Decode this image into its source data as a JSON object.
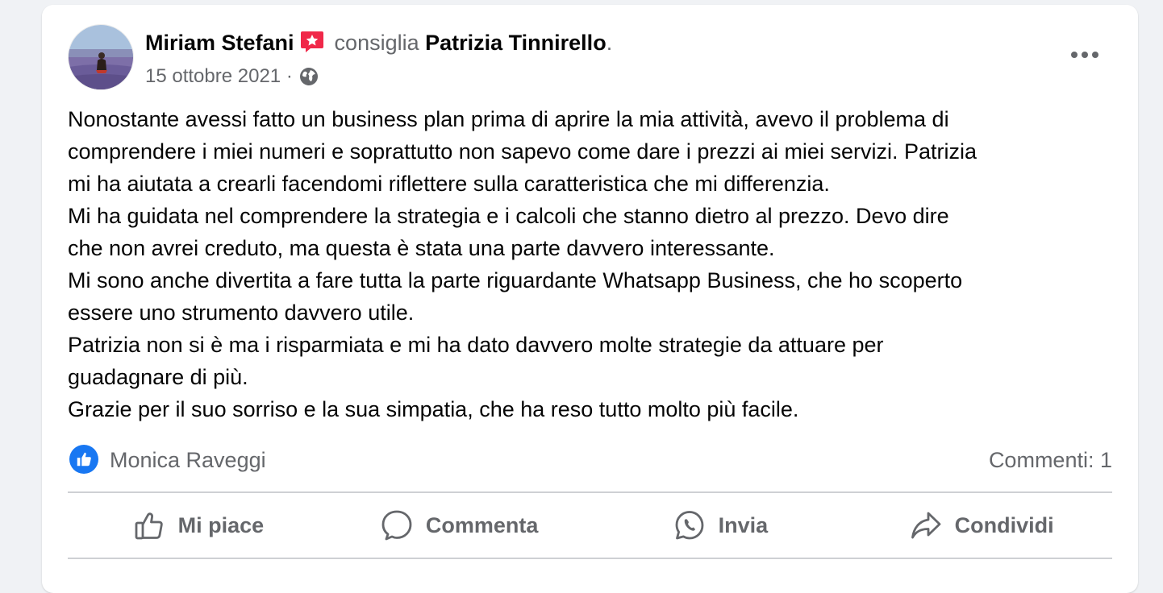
{
  "post": {
    "author": "Miriam Stefani",
    "verb": "consiglia",
    "page": "Patrizia Tinnirello",
    "page_end": ".",
    "date": "15 ottobre 2021",
    "date_sep": "·",
    "body_lines": [
      "Nonostante avessi fatto un business plan prima di aprire la mia attività, avevo il problema di",
      "comprendere i miei numeri e soprattutto  non sapevo come dare i prezzi ai miei servizi. Patrizia",
      "mi ha aiutata a crearli facendomi riflettere sulla caratteristica che mi differenzia.",
      "Mi ha guidata nel comprendere la strategia e i calcoli che stanno dietro al prezzo. Devo dire",
      "che non avrei creduto, ma questa è stata una parte davvero interessante.",
      "Mi sono anche divertita a fare tutta la parte riguardante Whatsapp Business, che ho scoperto",
      "essere uno strumento davvero utile.",
      "Patrizia non si è ma i risparmiata e mi ha dato davvero molte strategie da attuare per",
      "guadagnare di più.",
      "Grazie per il suo sorriso e la sua simpatia, che ha reso tutto molto più facile."
    ]
  },
  "reactions": {
    "reactor": "Monica Raveggi",
    "comments": "Commenti: 1"
  },
  "actions": {
    "like": "Mi piace",
    "comment": "Commenta",
    "send": "Invia",
    "share": "Condividi"
  },
  "icons": {
    "recommend": "recommend-star-icon",
    "globe": "globe-icon",
    "more": "more-horizontal-icon",
    "like_badge": "like-badge-icon",
    "like": "thumbs-up-icon",
    "comment": "comment-bubble-icon",
    "send": "whatsapp-icon",
    "share": "share-arrow-icon"
  },
  "colors": {
    "brand_blue": "#1877f2",
    "recommend_red": "#f02849",
    "secondary_text": "#65676b",
    "primary_text": "#050505",
    "divider": "#ced0d4"
  }
}
